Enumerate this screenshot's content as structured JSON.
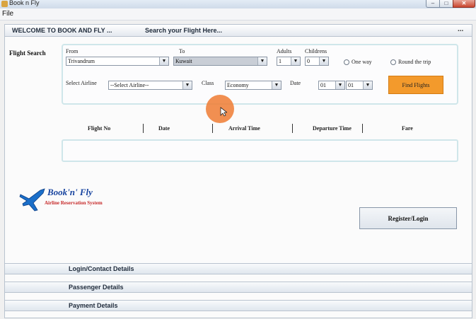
{
  "window": {
    "title": "Book n Fly",
    "min_icon": "minimize-icon",
    "max_icon": "maximize-icon",
    "close_icon": "close-icon"
  },
  "menu": {
    "file": "File"
  },
  "header": {
    "welcome": "WELCOME TO BOOK AND FLY ...",
    "search_title": "Search your Flight  Here...",
    "more": "..."
  },
  "flight_search": {
    "section_label": "Flight Search",
    "from_label": "From",
    "from_value": "Trivandrum",
    "to_label": "To",
    "to_value": "Kuwait",
    "adults_label": "Adults",
    "adults_value": "1",
    "childrens_label": "Childrens",
    "childrens_value": "0",
    "one_way_label": "One way",
    "round_trip_label": "Round the trip",
    "airline_label": "Select Airline",
    "airline_value": "--Select Airline--",
    "class_label": "Class",
    "class_value": "Economy",
    "date_label": "Date",
    "date_day": "01",
    "date_month": "01",
    "find_button": "Find Flights"
  },
  "results": {
    "columns": [
      "Flight No",
      "Date",
      "Arrival Time",
      "Departure Time",
      "Fare"
    ]
  },
  "logo": {
    "text": "Book'n' Fly",
    "subtitle": "Airline Reservation System",
    "icon": "airplane-icon"
  },
  "register_button": "Register/Login",
  "accordion": [
    "Login/Contact Details",
    "Passenger Details",
    "Payment Details"
  ],
  "colors": {
    "accent": "#f39a2c",
    "panel_border": "#cfe6ea",
    "logo_blue": "#1a46a0",
    "logo_red": "#c62828"
  }
}
